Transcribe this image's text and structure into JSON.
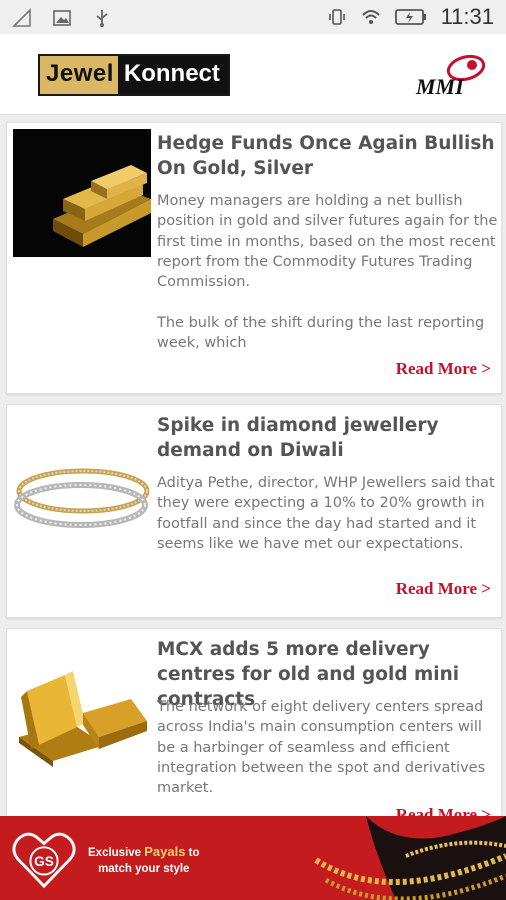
{
  "status_bar": {
    "time": "11:31",
    "icons": [
      "signal-icon",
      "image-icon",
      "usb-icon",
      "vibrate-icon",
      "wifi-icon",
      "battery-charging-icon"
    ]
  },
  "header": {
    "logo_part1": "Jewel",
    "logo_part2": "Konnect",
    "partner_logo": "MMI"
  },
  "articles": [
    {
      "title": "Hedge Funds Once Again Bullish On Gold, Silver",
      "excerpt": "Money managers are holding a net bullish position in gold and silver futures again for the first time in months, based on the most recent report from the Commodity Futures Trading Commission.\n\nThe bulk of the shift during the last reporting week, which",
      "read_more": "Read More >",
      "image": "gold-bars-image"
    },
    {
      "title": "Spike in diamond jewellery demand on Diwali",
      "excerpt": "Aditya Pethe, director, WHP Jewellers said that they were expecting a 10% to 20% growth in footfall and since the day had started and it seems like we have met our expectations.",
      "read_more": "Read More >",
      "image": "diamond-bangles-image"
    },
    {
      "title": "MCX adds 5 more delivery centres for old and gold mini contracts",
      "excerpt": "The network of eight delivery centers spread across India's main consumption centers will be a harbinger of seamless and efficient integration between the spot and derivatives market.",
      "read_more": "Read More >",
      "image": "gold-bullion-image"
    }
  ],
  "ad_banner": {
    "brand": "GS",
    "line1_prefix": "Exclusive ",
    "line1_highlight": "Payals",
    "line1_suffix": " to",
    "line2": "match your style"
  },
  "colors": {
    "accent_red": "#c8102e",
    "ad_background": "#c41c1e",
    "logo_gold": "#d9b765"
  }
}
